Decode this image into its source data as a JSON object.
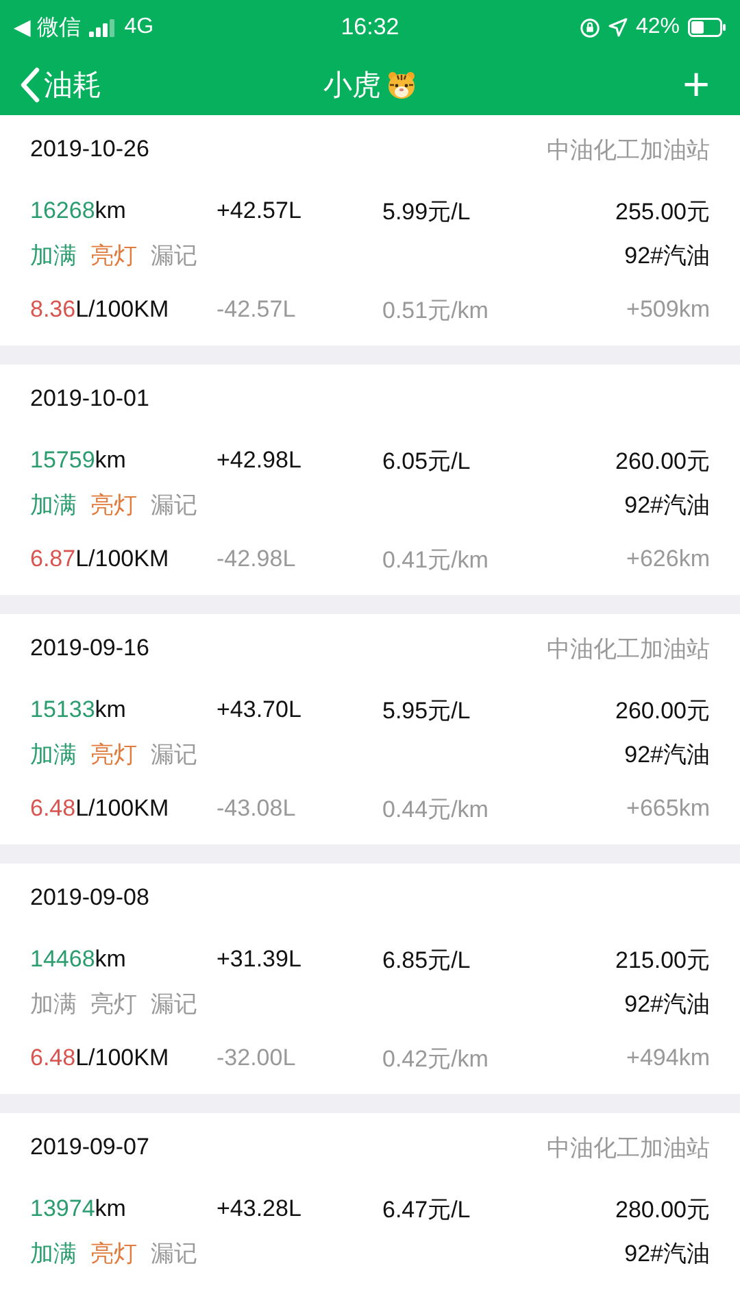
{
  "status_bar": {
    "back_app": "◀ 微信",
    "network": "4G",
    "time": "16:32",
    "battery": "42%"
  },
  "nav": {
    "back": "油耗",
    "title": "小虎",
    "add": "+"
  },
  "records": [
    {
      "date": "2019-10-26",
      "station": "中油化工加油站",
      "odometer": {
        "value": "16268",
        "unit": "km"
      },
      "volume": "+42.57L",
      "unit_price": "5.99元/L",
      "amount": "255.00元",
      "tags": [
        {
          "kind": "full",
          "label": "加满",
          "on": true
        },
        {
          "kind": "light",
          "label": "亮灯",
          "on": true
        },
        {
          "kind": "missed",
          "label": "漏记",
          "on": false
        }
      ],
      "fuel": "92#汽油",
      "consumption": {
        "value": "8.36",
        "unit": "L/100KM"
      },
      "used": "-42.57L",
      "cost_per_km": "0.51元/km",
      "distance": "+509km"
    },
    {
      "date": "2019-10-01",
      "odometer": {
        "value": "15759",
        "unit": "km"
      },
      "volume": "+42.98L",
      "unit_price": "6.05元/L",
      "amount": "260.00元",
      "tags": [
        {
          "kind": "full",
          "label": "加满",
          "on": true
        },
        {
          "kind": "light",
          "label": "亮灯",
          "on": true
        },
        {
          "kind": "missed",
          "label": "漏记",
          "on": false
        }
      ],
      "fuel": "92#汽油",
      "consumption": {
        "value": "6.87",
        "unit": "L/100KM"
      },
      "used": "-42.98L",
      "cost_per_km": "0.41元/km",
      "distance": "+626km"
    },
    {
      "date": "2019-09-16",
      "station": "中油化工加油站",
      "odometer": {
        "value": "15133",
        "unit": "km"
      },
      "volume": "+43.70L",
      "unit_price": "5.95元/L",
      "amount": "260.00元",
      "tags": [
        {
          "kind": "full",
          "label": "加满",
          "on": true
        },
        {
          "kind": "light",
          "label": "亮灯",
          "on": true
        },
        {
          "kind": "missed",
          "label": "漏记",
          "on": false
        }
      ],
      "fuel": "92#汽油",
      "consumption": {
        "value": "6.48",
        "unit": "L/100KM"
      },
      "used": "-43.08L",
      "cost_per_km": "0.44元/km",
      "distance": "+665km"
    },
    {
      "date": "2019-09-08",
      "odometer": {
        "value": "14468",
        "unit": "km"
      },
      "volume": "+31.39L",
      "unit_price": "6.85元/L",
      "amount": "215.00元",
      "tags": [
        {
          "kind": "full",
          "label": "加满",
          "on": false
        },
        {
          "kind": "light",
          "label": "亮灯",
          "on": false
        },
        {
          "kind": "missed",
          "label": "漏记",
          "on": false
        }
      ],
      "fuel": "92#汽油",
      "consumption": {
        "value": "6.48",
        "unit": "L/100KM"
      },
      "used": "-32.00L",
      "cost_per_km": "0.42元/km",
      "distance": "+494km"
    },
    {
      "date": "2019-09-07",
      "station": "中油化工加油站",
      "odometer": {
        "value": "13974",
        "unit": "km"
      },
      "volume": "+43.28L",
      "unit_price": "6.47元/L",
      "amount": "280.00元",
      "tags": [
        {
          "kind": "full",
          "label": "加满",
          "on": true
        },
        {
          "kind": "light",
          "label": "亮灯",
          "on": true
        },
        {
          "kind": "missed",
          "label": "漏记",
          "on": false
        }
      ],
      "fuel": "92#汽油"
    }
  ]
}
